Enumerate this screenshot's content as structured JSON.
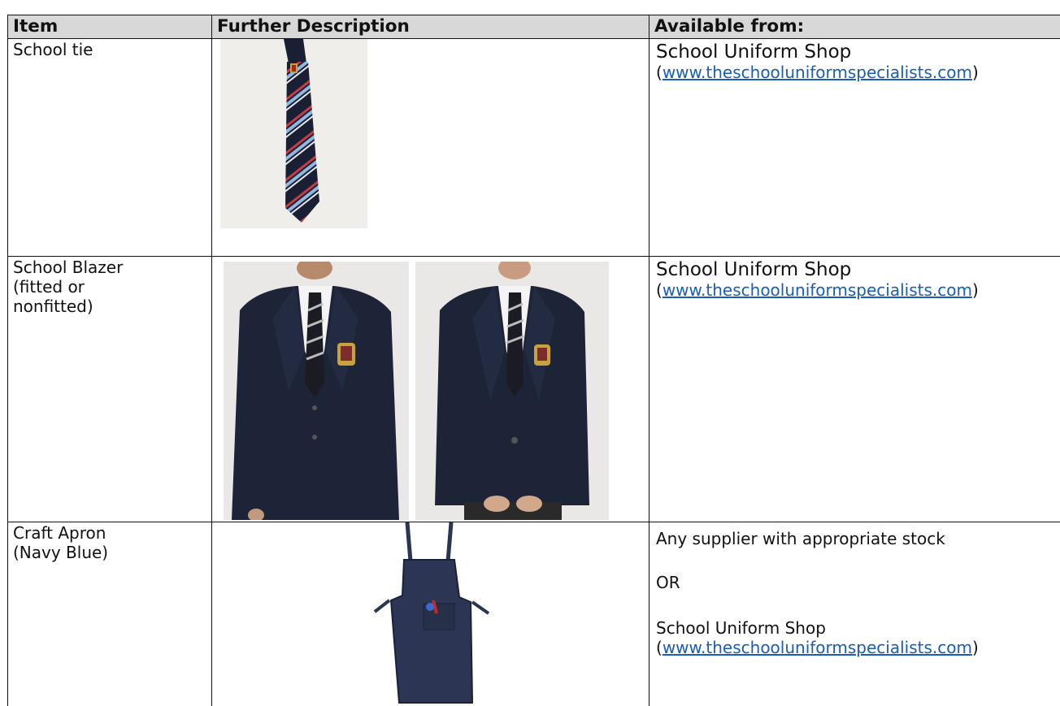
{
  "table": {
    "headers": [
      "Item",
      "Further Description",
      "Available from:"
    ],
    "rows": [
      {
        "item": "School tie",
        "available": {
          "line1": "School Uniform Shop",
          "paren_open": "(",
          "url": "www.theschooluniformspecialists.com",
          "paren_close": ")"
        }
      },
      {
        "item": "School Blazer\n(fitted or\nnonfitted)",
        "available": {
          "line1": "School Uniform Shop",
          "paren_open": "(",
          "url": "www.theschooluniformspecialists.com",
          "paren_close": ")"
        }
      },
      {
        "item": "Craft Apron\n(Navy Blue)",
        "available": {
          "line1": "Any supplier with appropriate stock",
          "or": "OR",
          "line2": "School Uniform Shop",
          "paren_open": "(",
          "url": "www.theschooluniformspecialists.com",
          "paren_close": ")"
        }
      }
    ]
  },
  "colors": {
    "header_bg": "#d8d8d8",
    "link": "#1a5db5",
    "navy": "#1d2438",
    "border": "#111111"
  },
  "images": [
    "tie-photo",
    "blazer-photo-boy",
    "blazer-photo-girl",
    "apron-photo"
  ]
}
